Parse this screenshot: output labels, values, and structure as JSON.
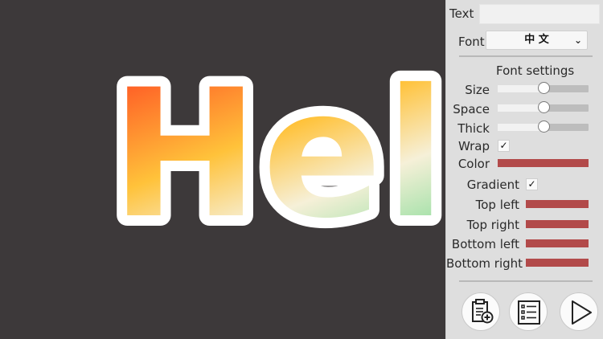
{
  "canvas": {
    "text": "Hello"
  },
  "panel": {
    "text_label": "Text",
    "text_value": "",
    "font_label": "Font",
    "font_value": "中 文",
    "font_settings_title": "Font settings",
    "size_label": "Size",
    "size_value": 0.5,
    "space_label": "Space",
    "space_value": 0.5,
    "thick_label": "Thick",
    "thick_value": 0.5,
    "wrap_label": "Wrap",
    "wrap_checked": "✓",
    "color_label": "Color",
    "color_value": "#b24a4a",
    "gradient_label": "Gradient",
    "gradient_checked": "✓",
    "top_left_label": "Top left",
    "top_left_color": "#b24a4a",
    "top_right_label": "Top right",
    "top_right_color": "#b24a4a",
    "bottom_left_label": "Bottom left",
    "bottom_left_color": "#b24a4a",
    "bottom_right_label": "Bottom right",
    "bottom_right_color": "#b24a4a"
  },
  "toolbar": {
    "paste_icon": "clipboard-add-icon",
    "list_icon": "checklist-icon",
    "play_icon": "play-icon"
  }
}
